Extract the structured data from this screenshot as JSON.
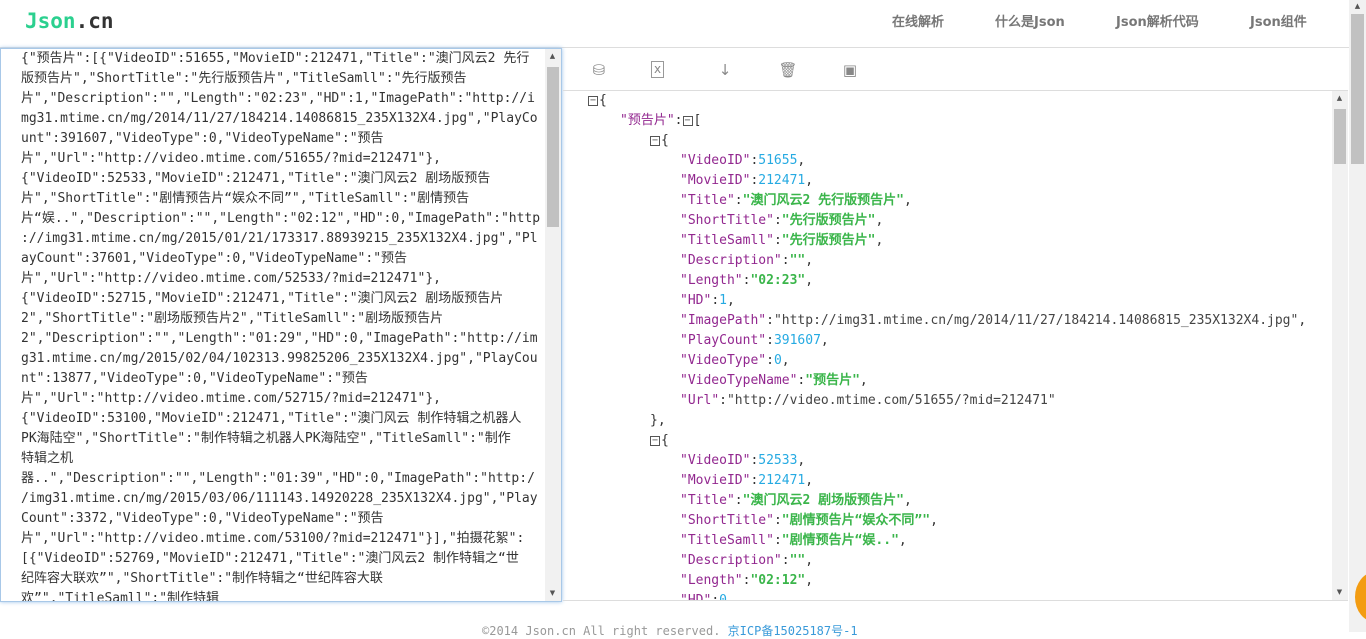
{
  "header": {
    "logo_a": "Json",
    "logo_b": ".cn",
    "nav": [
      "在线解析",
      "什么是Json",
      "Json解析代码",
      "Json组件"
    ]
  },
  "toolbar": {
    "icons": [
      "database-icon",
      "excel-icon",
      "sort-icon",
      "trash-icon",
      "save-icon"
    ]
  },
  "input": {
    "lines": [
      "{\"预告片\":[{\"VideoID\":51655,\"MovieID\":212471,\"Title\":\"澳门风云2 先行",
      "版预告片\",\"ShortTitle\":\"先行版预告片\",\"TitleSamll\":\"先行版预告",
      "片\",\"Description\":\"\",\"Length\":\"02:23\",\"HD\":1,\"ImagePath\":\"http://i",
      "mg31.mtime.cn/mg/2014/11/27/184214.14086815_235X132X4.jpg\",\"PlayCo",
      "unt\":391607,\"VideoType\":0,\"VideoTypeName\":\"预告",
      "片\",\"Url\":\"http://video.mtime.com/51655/?mid=212471\"},",
      "{\"VideoID\":52533,\"MovieID\":212471,\"Title\":\"澳门风云2 剧场版预告",
      "片\",\"ShortTitle\":\"剧情预告片“娱众不同”\",\"TitleSamll\":\"剧情预告",
      "片“娱..\",\"Description\":\"\",\"Length\":\"02:12\",\"HD\":0,\"ImagePath\":\"http",
      "://img31.mtime.cn/mg/2015/01/21/173317.88939215_235X132X4.jpg\",\"Pl",
      "ayCount\":37601,\"VideoType\":0,\"VideoTypeName\":\"预告",
      "片\",\"Url\":\"http://video.mtime.com/52533/?mid=212471\"},",
      "{\"VideoID\":52715,\"MovieID\":212471,\"Title\":\"澳门风云2 剧场版预告片",
      "2\",\"ShortTitle\":\"剧场版预告片2\",\"TitleSamll\":\"剧场版预告片",
      "2\",\"Description\":\"\",\"Length\":\"01:29\",\"HD\":0,\"ImagePath\":\"http://im",
      "g31.mtime.cn/mg/2015/02/04/102313.99825206_235X132X4.jpg\",\"PlayCou",
      "nt\":13877,\"VideoType\":0,\"VideoTypeName\":\"预告",
      "片\",\"Url\":\"http://video.mtime.com/52715/?mid=212471\"},",
      "{\"VideoID\":53100,\"MovieID\":212471,\"Title\":\"澳门风云 制作特辑之机器人",
      "PK海陆空\",\"ShortTitle\":\"制作特辑之机器人PK海陆空\",\"TitleSamll\":\"制作",
      "特辑之机",
      "器..\",\"Description\":\"\",\"Length\":\"01:39\",\"HD\":0,\"ImagePath\":\"http:/",
      "/img31.mtime.cn/mg/2015/03/06/111143.14920228_235X132X4.jpg\",\"Play",
      "Count\":3372,\"VideoType\":0,\"VideoTypeName\":\"预告",
      "片\",\"Url\":\"http://video.mtime.com/53100/?mid=212471\"}],\"拍摄花絮\":",
      "[{\"VideoID\":52769,\"MovieID\":212471,\"Title\":\"澳门风云2 制作特辑之“世",
      "纪阵容大联欢”\",\"ShortTitle\":\"制作特辑之“世纪阵容大联",
      "欢”\",\"TitleSamll\":\"制作特辑"
    ]
  },
  "tree": [
    {
      "l": 0,
      "open": "{",
      "t": true
    },
    {
      "l": 1,
      "k": "预告片",
      "open": "[",
      "t": true
    },
    {
      "l": 2,
      "open": "{",
      "t": true
    },
    {
      "l": 3,
      "k": "VideoID",
      "v": "51655",
      "vt": "n",
      "c": true
    },
    {
      "l": 3,
      "k": "MovieID",
      "v": "212471",
      "vt": "n",
      "c": true
    },
    {
      "l": 3,
      "k": "Title",
      "v": "澳门风云2 先行版预告片",
      "vt": "s",
      "c": true
    },
    {
      "l": 3,
      "k": "ShortTitle",
      "v": "先行版预告片",
      "vt": "s",
      "c": true
    },
    {
      "l": 3,
      "k": "TitleSamll",
      "v": "先行版预告片",
      "vt": "s",
      "c": true
    },
    {
      "l": 3,
      "k": "Description",
      "v": "",
      "vt": "s",
      "c": true
    },
    {
      "l": 3,
      "k": "Length",
      "v": "02:23",
      "vt": "s",
      "c": true
    },
    {
      "l": 3,
      "k": "HD",
      "v": "1",
      "vt": "n",
      "c": true
    },
    {
      "l": 3,
      "k": "ImagePath",
      "v": "http://img31.mtime.cn/mg/2014/11/27/184214.14086815_235X132X4.jpg",
      "vt": "u",
      "c": true
    },
    {
      "l": 3,
      "k": "PlayCount",
      "v": "391607",
      "vt": "n",
      "c": true
    },
    {
      "l": 3,
      "k": "VideoType",
      "v": "0",
      "vt": "n",
      "c": true
    },
    {
      "l": 3,
      "k": "VideoTypeName",
      "v": "预告片",
      "vt": "s",
      "c": true
    },
    {
      "l": 3,
      "k": "Url",
      "v": "http://video.mtime.com/51655/?mid=212471",
      "vt": "u",
      "c": false
    },
    {
      "l": 2,
      "close": "},"
    },
    {
      "l": 2,
      "open": "{",
      "t": true
    },
    {
      "l": 3,
      "k": "VideoID",
      "v": "52533",
      "vt": "n",
      "c": true
    },
    {
      "l": 3,
      "k": "MovieID",
      "v": "212471",
      "vt": "n",
      "c": true
    },
    {
      "l": 3,
      "k": "Title",
      "v": "澳门风云2 剧场版预告片",
      "vt": "s",
      "c": true
    },
    {
      "l": 3,
      "k": "ShortTitle",
      "v": "剧情预告片“娱众不同”",
      "vt": "s",
      "c": true
    },
    {
      "l": 3,
      "k": "TitleSamll",
      "v": "剧情预告片“娱..",
      "vt": "s",
      "c": true
    },
    {
      "l": 3,
      "k": "Description",
      "v": "",
      "vt": "s",
      "c": true
    },
    {
      "l": 3,
      "k": "Length",
      "v": "02:12",
      "vt": "s",
      "c": true
    },
    {
      "l": 3,
      "k": "HD",
      "v": "0",
      "vt": "n",
      "c": true
    }
  ],
  "colors": {
    "key": "#92278f",
    "number": "#25aae2",
    "string": "#3ab54a",
    "logo": "#2bd08f"
  },
  "footer": {
    "copyright": "©2014 Json.cn All right reserved. ",
    "icp": "京ICP备15025187号-1"
  }
}
